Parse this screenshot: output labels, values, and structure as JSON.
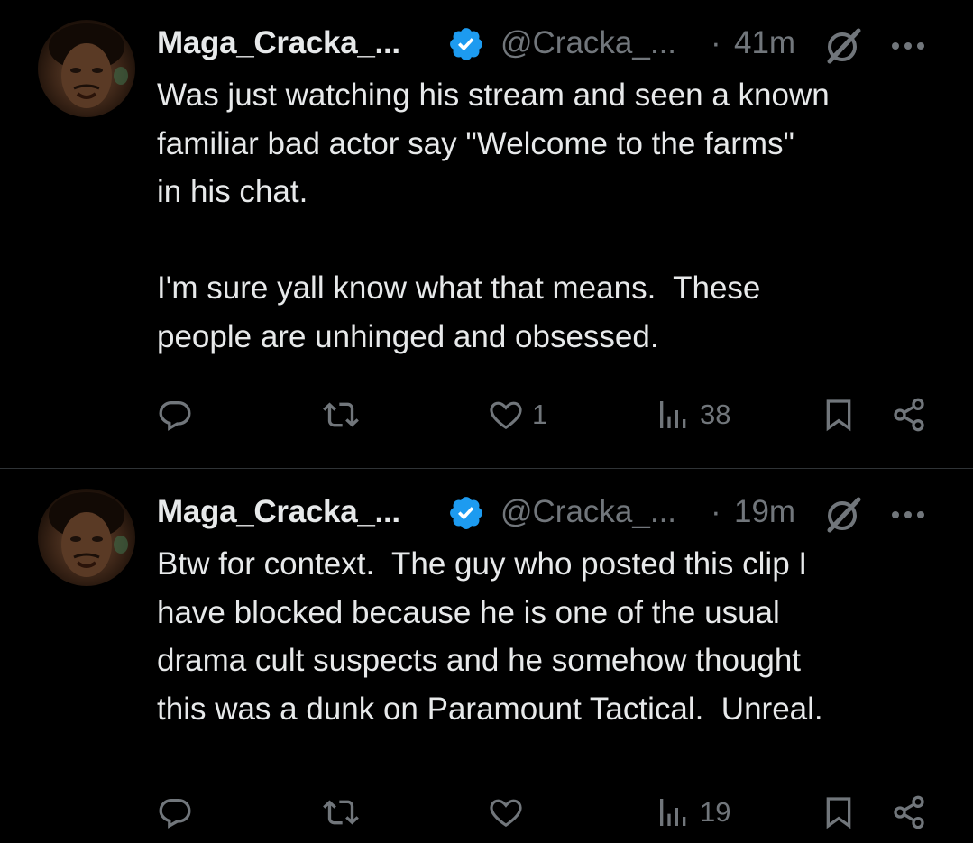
{
  "posts": [
    {
      "author": {
        "name": "Maga_Cracka_...",
        "handle": "@Cracka_...",
        "verified": true
      },
      "separator": "·",
      "time": "41m",
      "text": "Was just watching his stream and seen a known\nfamiliar bad actor say \"Welcome to the farms\"\nin his chat.\n\nI'm sure yall know what that means.  These\npeople are unhinged and obsessed.",
      "actions": {
        "replies": "",
        "reposts": "",
        "likes": "1",
        "views": "38"
      }
    },
    {
      "author": {
        "name": "Maga_Cracka_...",
        "handle": "@Cracka_...",
        "verified": true
      },
      "separator": "·",
      "time": "19m",
      "text": "Btw for context.  The guy who posted this clip I\nhave blocked because he is one of the usual\ndrama cult suspects and he somehow thought\nthis was a dunk on Paramount Tactical.  Unreal.",
      "actions": {
        "replies": "",
        "reposts": "",
        "likes": "",
        "views": "19"
      }
    }
  ],
  "icons": {
    "reply": "reply-icon",
    "repost": "repost-icon",
    "like": "heart-icon",
    "views": "views-icon",
    "bookmark": "bookmark-icon",
    "share": "share-icon",
    "grok": "grok-icon",
    "more": "more-icon",
    "verified": "verified-badge-icon"
  },
  "colors": {
    "background": "#000000",
    "text": "#e7e9ea",
    "muted": "#71767b",
    "verified": "#1d9bf0",
    "divider": "#2f3336"
  }
}
